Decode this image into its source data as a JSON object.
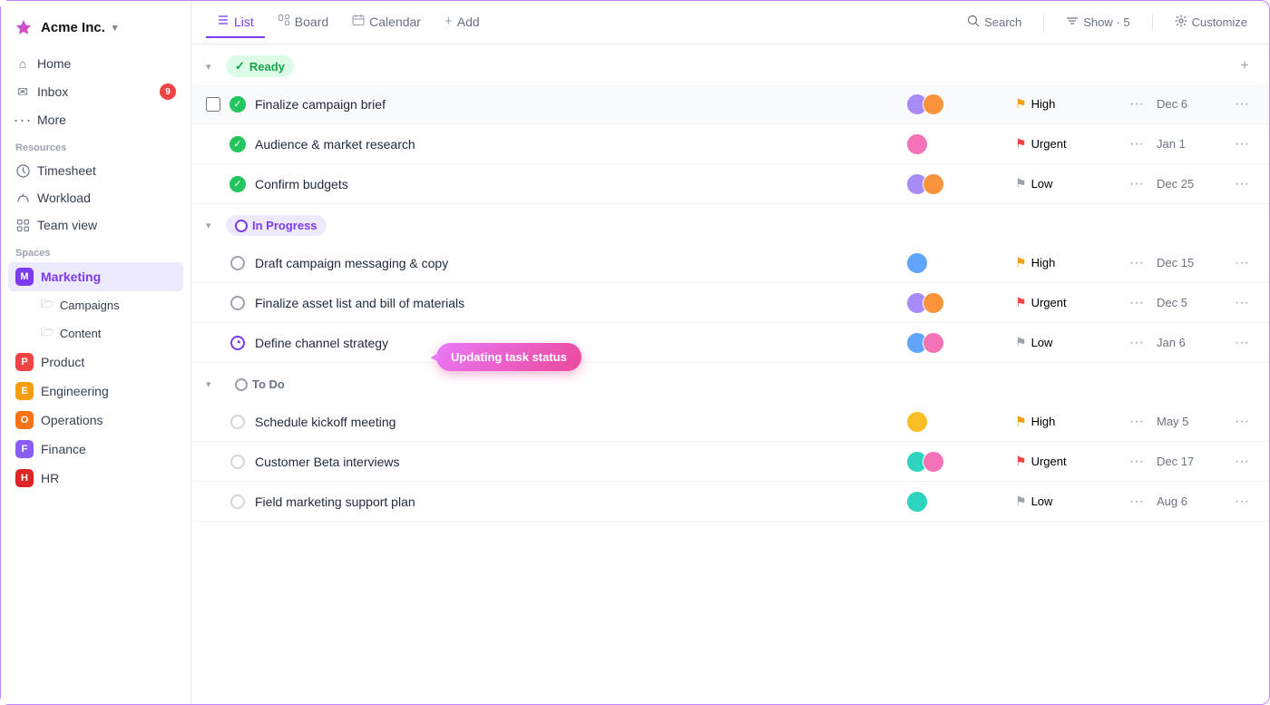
{
  "app": {
    "title": "Acme Inc.",
    "chevron": "▾"
  },
  "sidebar": {
    "nav": [
      {
        "id": "home",
        "label": "Home",
        "icon": "⌂"
      },
      {
        "id": "inbox",
        "label": "Inbox",
        "icon": "✉",
        "badge": "9"
      },
      {
        "id": "more",
        "label": "More",
        "icon": "⋯"
      }
    ],
    "resources_label": "Resources",
    "resources": [
      {
        "id": "timesheet",
        "label": "Timesheet",
        "icon": "⏱"
      },
      {
        "id": "workload",
        "label": "Workload",
        "icon": "↻"
      },
      {
        "id": "teamview",
        "label": "Team view",
        "icon": "⊞"
      }
    ],
    "spaces_label": "Spaces",
    "spaces": [
      {
        "id": "marketing",
        "label": "Marketing",
        "badge": "M",
        "class": "m",
        "active": true
      },
      {
        "id": "product",
        "label": "Product",
        "badge": "P",
        "class": "p"
      },
      {
        "id": "engineering",
        "label": "Engineering",
        "badge": "E",
        "class": "e"
      },
      {
        "id": "operations",
        "label": "Operations",
        "badge": "O",
        "class": "o"
      },
      {
        "id": "finance",
        "label": "Finance",
        "badge": "F",
        "class": "f"
      },
      {
        "id": "hr",
        "label": "HR",
        "badge": "H",
        "class": "h"
      }
    ],
    "sub_items": [
      {
        "label": "Campaigns"
      },
      {
        "label": "Content"
      }
    ]
  },
  "topbar": {
    "tabs": [
      {
        "id": "list",
        "label": "List",
        "icon": "≡",
        "active": true
      },
      {
        "id": "board",
        "label": "Board",
        "icon": "⊞"
      },
      {
        "id": "calendar",
        "label": "Calendar",
        "icon": "📅"
      },
      {
        "id": "add",
        "label": "Add",
        "icon": "+"
      }
    ],
    "actions": [
      {
        "id": "search",
        "label": "Search",
        "icon": "🔍"
      },
      {
        "id": "show",
        "label": "Show · 5",
        "icon": "⊟"
      },
      {
        "id": "customize",
        "label": "Customize",
        "icon": "⚙"
      }
    ]
  },
  "groups": [
    {
      "id": "ready",
      "label": "Ready",
      "type": "ready",
      "tasks": [
        {
          "id": "t1",
          "name": "Finalize campaign brief",
          "status": "done",
          "priority": "High",
          "priority_class": "high",
          "more": "···",
          "date": "Dec 6",
          "avatars": [
            "purple",
            "orange"
          ],
          "highlighted": true
        },
        {
          "id": "t2",
          "name": "Audience & market research",
          "status": "done",
          "priority": "Urgent",
          "priority_class": "urgent",
          "more": "···",
          "date": "Jan 1",
          "avatars": [
            "pink"
          ]
        },
        {
          "id": "t3",
          "name": "Confirm budgets",
          "status": "done",
          "priority": "Low",
          "priority_class": "low",
          "more": "···",
          "date": "Dec 25",
          "avatars": [
            "purple",
            "orange"
          ]
        }
      ]
    },
    {
      "id": "in-progress",
      "label": "In Progress",
      "type": "in-progress",
      "tasks": [
        {
          "id": "t4",
          "name": "Draft campaign messaging & copy",
          "status": "open",
          "priority": "High",
          "priority_class": "high",
          "more": "···",
          "date": "Dec 15",
          "avatars": [
            "blue"
          ]
        },
        {
          "id": "t5",
          "name": "Finalize asset list and bill of materials",
          "status": "open",
          "priority": "Urgent",
          "priority_class": "urgent",
          "more": "···",
          "date": "Dec 5",
          "avatars": [
            "purple",
            "orange"
          ]
        },
        {
          "id": "t6",
          "name": "Define channel strategy",
          "status": "progress",
          "priority": "Low",
          "priority_class": "low",
          "more": "···",
          "date": "Jan 6",
          "avatars": [
            "blue",
            "pink"
          ],
          "tooltip": "Updating task status"
        }
      ]
    },
    {
      "id": "to-do",
      "label": "To Do",
      "type": "to-do",
      "tasks": [
        {
          "id": "t7",
          "name": "Schedule kickoff meeting",
          "status": "circle",
          "priority": "High",
          "priority_class": "high",
          "more": "···",
          "date": "May 5",
          "avatars": [
            "yellow"
          ]
        },
        {
          "id": "t8",
          "name": "Customer Beta interviews",
          "status": "circle",
          "priority": "Urgent",
          "priority_class": "urgent",
          "more": "···",
          "date": "Dec 17",
          "avatars": [
            "teal",
            "pink"
          ]
        },
        {
          "id": "t9",
          "name": "Field marketing support plan",
          "status": "circle",
          "priority": "Low",
          "priority_class": "low",
          "more": "···",
          "date": "Aug 6",
          "avatars": [
            "teal"
          ]
        }
      ]
    }
  ],
  "icons": {
    "check": "✓",
    "chevron_down": "▾",
    "add": "+",
    "more_h": "···",
    "search": "⌕",
    "show": "⊟",
    "gear": "⚙",
    "home": "⌂",
    "inbox": "✉",
    "timesheet": "⏱",
    "workload": "◑",
    "teamview": "⊞",
    "folder": "🗁",
    "list": "≡",
    "board": "⊞",
    "calendar": "📅"
  }
}
